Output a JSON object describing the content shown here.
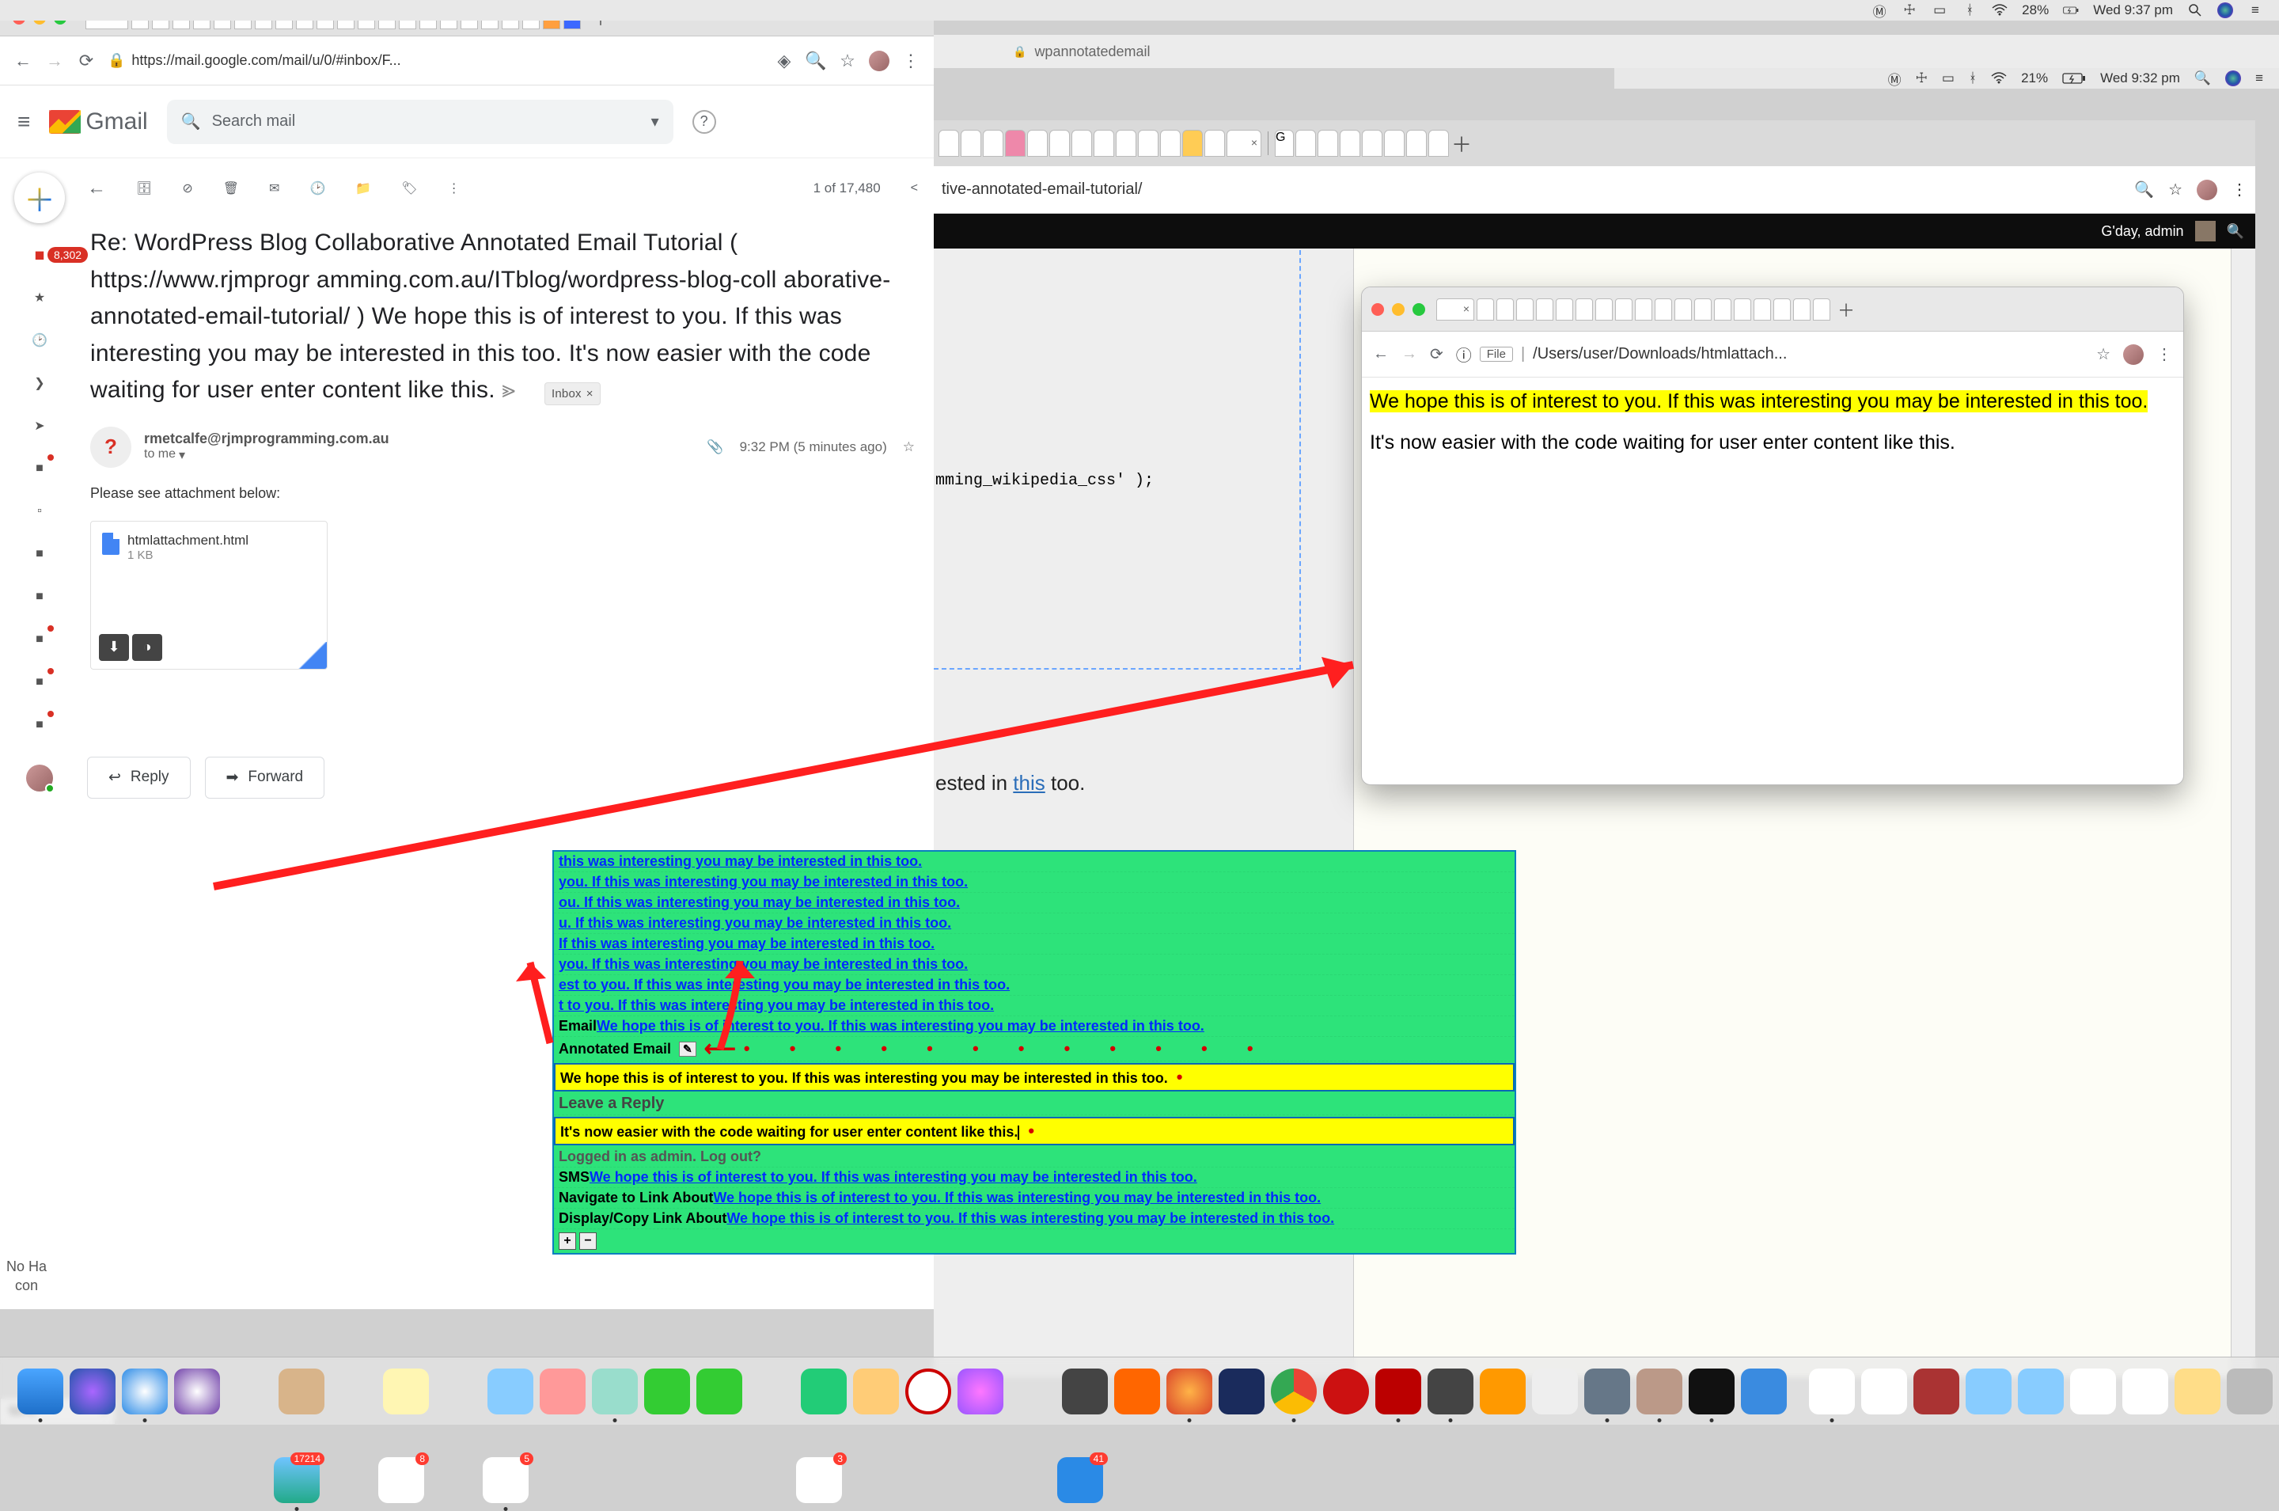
{
  "menubar1": {
    "battery": "28%",
    "clock": "Wed 9:37 pm"
  },
  "menubar2": {
    "battery": "21%",
    "clock": "Wed 9:32 pm"
  },
  "rear_tab_title": "wpannotatedemail",
  "rear_addr_tail": "tive-annotated-email-tutorial/",
  "rear_admin": "G'day, admin",
  "peek_code": "mming_wikipedia_css' );",
  "peek_link_pre": "ested in ",
  "peek_link_word": "this",
  "peek_link_post": " too.",
  "front": {
    "url": "https://mail.google.com/mail/u/0/#inbox/F...",
    "gmail_label": "Gmail",
    "search_placeholder": "Search mail",
    "inbox_count": "8,302",
    "left_cut_a": "No Ha",
    "left_cut_b": "con",
    "toolbar_count": "1 of 17,480",
    "subject": "Re: WordPress Blog Collaborative Annotated Email Tutorial ( https://www.rjmprogr amming.com.au/ITblog/wordpress-blog-coll aborative-annotated-email-tutorial/ )        We hope this is of interest to you. If this was interesting you may be interested in this too. It's now easier with the code waiting for user enter content like this.",
    "inbox_chip": "Inbox",
    "from": "rmetcalfe@rjmprogramming.com.au",
    "to": "to me",
    "time": "9:32 PM (5 minutes ago)",
    "body": "Please see attachment below:",
    "attach_name": "htmlattachment.html",
    "attach_size": "1 KB",
    "reply": "Reply",
    "forward": "Forward"
  },
  "popup": {
    "file_label": "File",
    "url": "/Users/user/Downloads/htmlattach...",
    "line1": "We hope this is of interest to you. If this was interesting you may be interested in this too.",
    "line2": "It's now easier with the code waiting for user enter content like this."
  },
  "greenbox": {
    "rows_top": [
      " this was interesting you may be interested in this too.",
      " you. If this was interesting you may be interested in this too.",
      "ou. If this was interesting you may be interested in this too.",
      "u. If this was interesting you may be interested in this too.",
      "If this was interesting you may be interested in this too.",
      " you. If this was interesting you may be interested in this too.",
      "est to you. If this was interesting you may be interested in this too.",
      "t to you. If this was interesting you may be interested in this too."
    ],
    "email_label": "Email ",
    "email_link": "We hope this is of interest to you. If this was interesting you may be interested in this too.",
    "annotated_label": "Annotated Email",
    "yellow1": "We hope this is of interest to you. If this was interesting you may be interested in this too.",
    "leave": "Leave a Reply",
    "yellow2": "It's now easier with the code waiting for user enter content like this.",
    "logged": "Logged in as admin. Log out?",
    "sms_label": "SMS ",
    "sms_link": "We hope this is of interest to you. If this was interesting you may be interested in this too.",
    "nav_label": "Navigate to Link About ",
    "nav_link": "We hope this is of interest to you. If this was interesting you may be interested in this too.",
    "disp_label": "Display/Copy Link About ",
    "disp_link": "We hope this is of interest to you. If this was interesting you may be interested in this too."
  },
  "zoom": "50%"
}
